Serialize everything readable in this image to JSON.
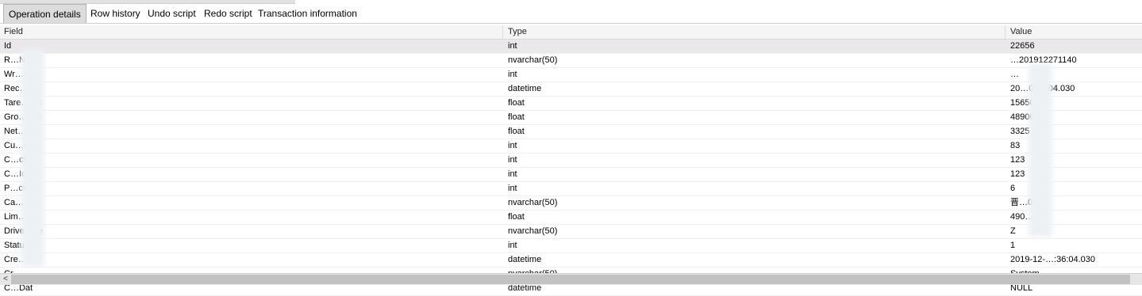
{
  "tabs": [
    {
      "label": "Operation details",
      "active": true
    },
    {
      "label": "Row history"
    },
    {
      "label": "Undo script"
    },
    {
      "label": "Redo script"
    },
    {
      "label": "Transaction information"
    }
  ],
  "columns": {
    "field": "Field",
    "type": "Type",
    "value": "Value"
  },
  "rows": [
    {
      "field": "Id",
      "type": "int",
      "value": "22656"
    },
    {
      "field": "R…No",
      "type": "nvarchar(50)",
      "value": "…201912271140"
    },
    {
      "field": "Wr…dId",
      "type": "int",
      "value": "…"
    },
    {
      "field": "Rec…ate",
      "type": "datetime",
      "value": "20…0:36:04.030"
    },
    {
      "field": "Tare…ght",
      "type": "float",
      "value": "15650"
    },
    {
      "field": "Gro…ight",
      "type": "float",
      "value": "48900"
    },
    {
      "field": "Net…ght",
      "type": "float",
      "value": "3325"
    },
    {
      "field": "Cu…erId",
      "type": "int",
      "value": "83"
    },
    {
      "field": "C…ctId",
      "type": "int",
      "value": "123"
    },
    {
      "field": "C…Id",
      "type": "int",
      "value": "123"
    },
    {
      "field": "P…ctId",
      "type": "int",
      "value": "6"
    },
    {
      "field": "Ca…",
      "type": "nvarchar(50)",
      "value": "晋…0X"
    },
    {
      "field": "Lim…ber",
      "type": "float",
      "value": "490…"
    },
    {
      "field": "Drive…ne",
      "type": "nvarchar(50)",
      "value": "Z"
    },
    {
      "field": "Statu…",
      "type": "int",
      "value": "1"
    },
    {
      "field": "Cre…te",
      "type": "datetime",
      "value": "2019-12-…:36:04.030"
    },
    {
      "field": "Cr…",
      "type": "nvarchar(50)",
      "value": "System"
    },
    {
      "field": "C…Dat",
      "type": "datetime",
      "value": "NULL"
    }
  ],
  "scrollbar": {
    "left_arrow": "<"
  }
}
